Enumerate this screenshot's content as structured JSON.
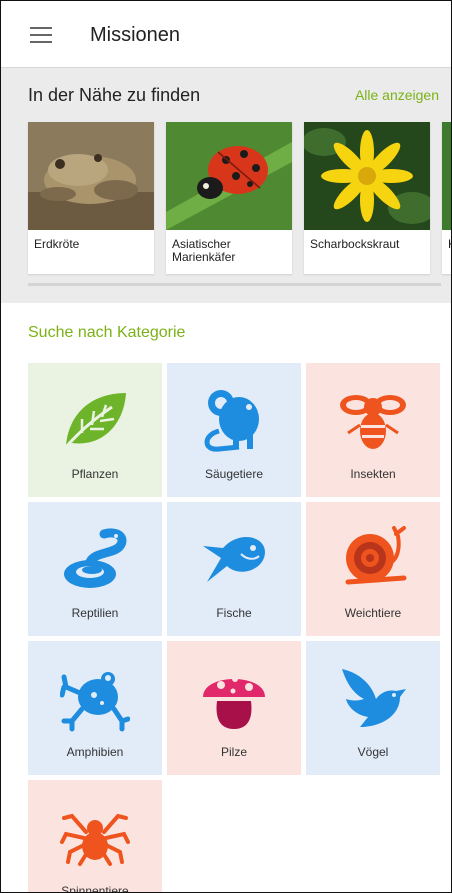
{
  "appbar": {
    "title": "Missionen"
  },
  "nearby": {
    "heading": "In der Nähe zu finden",
    "show_all": "Alle anzeigen",
    "cards": [
      {
        "name": "Erdkröte"
      },
      {
        "name": "Asiatischer Marienkäfer"
      },
      {
        "name": "Scharbockskraut"
      },
      {
        "name": "K"
      }
    ]
  },
  "categories": {
    "heading": "Suche nach Kategorie",
    "items": [
      {
        "label": "Pflanzen",
        "icon": "leaf-icon"
      },
      {
        "label": "Säugetiere",
        "icon": "mouse-icon"
      },
      {
        "label": "Insekten",
        "icon": "bee-icon"
      },
      {
        "label": "Reptilien",
        "icon": "snake-icon"
      },
      {
        "label": "Fische",
        "icon": "fish-icon"
      },
      {
        "label": "Weichtiere",
        "icon": "snail-icon"
      },
      {
        "label": "Amphibien",
        "icon": "frog-icon"
      },
      {
        "label": "Pilze",
        "icon": "mushroom-icon"
      },
      {
        "label": "Vögel",
        "icon": "bird-icon"
      },
      {
        "label": "Spinnentiere",
        "icon": "spider-icon"
      }
    ]
  },
  "colors": {
    "accent": "#7ab317",
    "plant": "#6db42b",
    "blue": "#1e8de0",
    "orange": "#f0541e",
    "pink": "#e0286a"
  }
}
